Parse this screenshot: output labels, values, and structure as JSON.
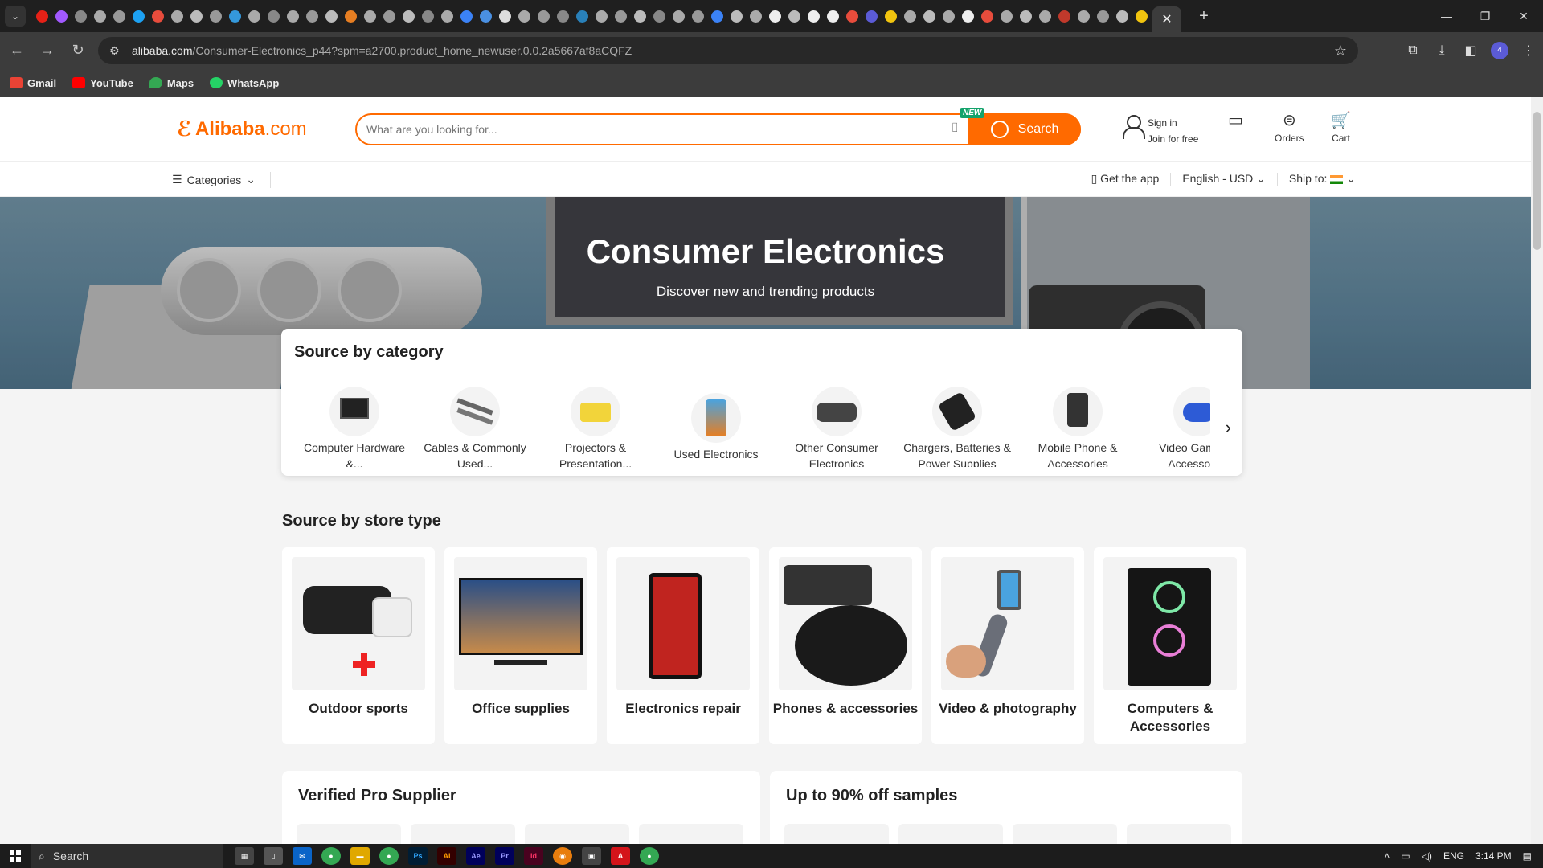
{
  "browser": {
    "url_domain": "alibaba.com",
    "url_path": "/Consumer-Electronics_p44?spm=a2700.product_home_newuser.0.0.2a5667af8aCQFZ",
    "profile_count": "4",
    "bookmarks": [
      {
        "label": "Gmail",
        "color": "#ea4335"
      },
      {
        "label": "YouTube",
        "color": "#ff0000"
      },
      {
        "label": "Maps",
        "color": "#34a853"
      },
      {
        "label": "WhatsApp",
        "color": "#25d366"
      }
    ]
  },
  "header": {
    "logo_text": "Alibaba",
    "logo_suffix": ".com",
    "search_placeholder": "What are you looking for...",
    "new_badge": "NEW",
    "search_button": "Search",
    "sign_in": "Sign in",
    "join": "Join for free",
    "orders": "Orders",
    "cart": "Cart",
    "accent": "#ff6a00"
  },
  "subnav": {
    "categories": "Categories",
    "get_app": "Get the app",
    "language": "English - USD",
    "ship_to": "Ship to:"
  },
  "hero": {
    "title": "Consumer Electronics",
    "subtitle": "Discover new and trending products"
  },
  "source_by_category": {
    "title": "Source by category",
    "items": [
      {
        "label": "Computer Hardware &..."
      },
      {
        "label": "Cables & Commonly Used..."
      },
      {
        "label": "Projectors & Presentation..."
      },
      {
        "label": "Used Electronics"
      },
      {
        "label": "Other Consumer Electronics"
      },
      {
        "label": "Chargers, Batteries & Power Supplies"
      },
      {
        "label": "Mobile Phone & Accessories"
      },
      {
        "label": "Video Games & Accessories"
      }
    ]
  },
  "source_by_store": {
    "title": "Source by store type",
    "items": [
      {
        "label": "Outdoor sports"
      },
      {
        "label": "Office supplies"
      },
      {
        "label": "Electronics repair"
      },
      {
        "label": "Phones & accessories"
      },
      {
        "label": "Video & photography"
      },
      {
        "label": "Computers & Accessories"
      }
    ]
  },
  "bottom": {
    "verified": "Verified Pro Supplier",
    "samples": "Up to 90% off samples"
  },
  "taskbar": {
    "search": "Search",
    "lang": "ENG",
    "time": "3:14 PM"
  }
}
